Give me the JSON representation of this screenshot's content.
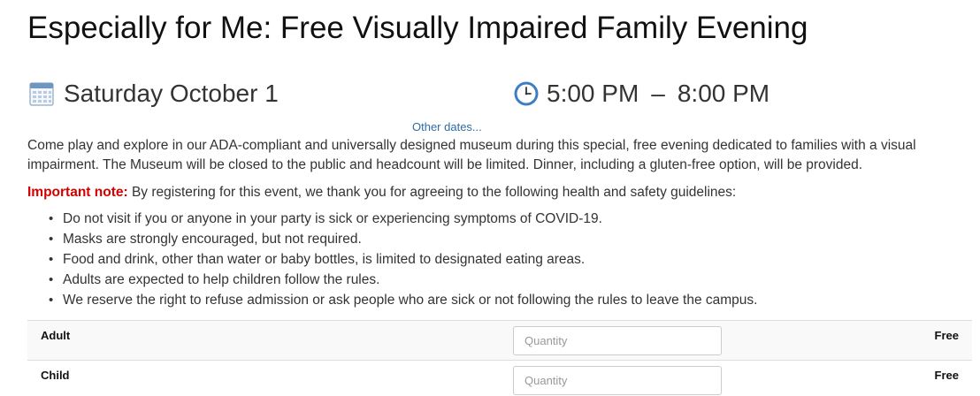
{
  "event": {
    "title": "Especially for Me: Free Visually Impaired Family Evening",
    "date": "Saturday October 1",
    "start_time": "5:00 PM",
    "separator": "–",
    "end_time": "8:00 PM",
    "other_dates_link": "Other dates...",
    "calendar_icon": "calendar-icon",
    "clock_icon": "clock-icon"
  },
  "description": "Come play and explore in our ADA-compliant and universally designed museum during this special, free evening dedicated to families with a visual impairment. The Museum will be closed to the public and headcount will be limited. Dinner, including a gluten-free option, will be provided.",
  "important_note": {
    "label": "Important note:",
    "text": " By registering for this event, we thank you for agreeing to the following health and safety guidelines:",
    "label_color": "#d40000"
  },
  "guidelines": [
    "Do not visit if you or anyone in your party is sick or experiencing symptoms of COVID-19.",
    "Masks are strongly encouraged, but not required.",
    "Food and drink, other than water or baby bottles, is limited to designated eating areas.",
    "Adults are expected to help children follow the rules.",
    "We reserve the right to refuse admission or ask people who are sick or not following the rules to leave the campus."
  ],
  "tickets": [
    {
      "type": "Adult",
      "quantity_placeholder": "Quantity",
      "quantity_value": "",
      "price": "Free"
    },
    {
      "type": "Child",
      "quantity_placeholder": "Quantity",
      "quantity_value": "",
      "price": "Free"
    }
  ],
  "colors": {
    "link": "#2e6da4",
    "row_alt_bg": "#f9f9f9"
  }
}
